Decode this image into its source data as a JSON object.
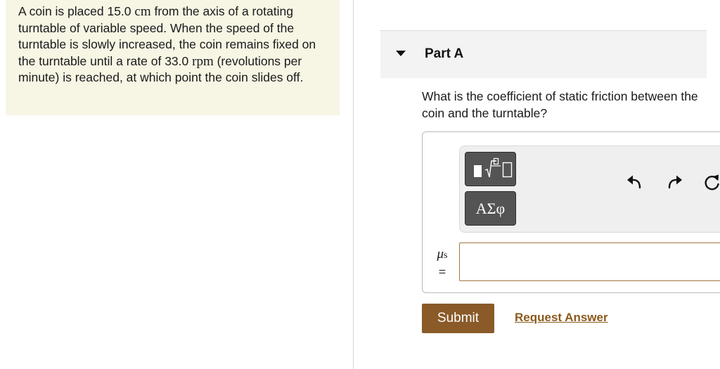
{
  "problem": {
    "text_1": "A coin is placed 15.0 ",
    "unit_cm": "cm",
    "text_2": " from the axis of a rotating turntable of variable speed. When the speed of the turntable is slowly increased, the coin remains fixed on the turntable until a rate of 33.0 ",
    "unit_rpm": "rpm",
    "text_3": " (revolutions per minute) is reached, at which point the coin slides off."
  },
  "part": {
    "title": "Part A",
    "question": "What is the coefficient of static friction between the coin and the turntable?"
  },
  "toolbar": {
    "templates_icon": "fraction-sqrt-template-icon",
    "symbols_label": "ΑΣφ",
    "undo_icon": "undo-icon",
    "redo_icon": "redo-icon",
    "reset_icon": "reset-icon"
  },
  "answer": {
    "var_symbol": "μ",
    "var_subscript": "s",
    "equals": "=",
    "value": ""
  },
  "actions": {
    "submit_label": "Submit",
    "request_label": "Request Answer"
  },
  "colors": {
    "problem_bg": "#f7f5e4",
    "submit_bg": "#8a5a28",
    "link": "#8a5a1c",
    "input_border": "#a0753a"
  }
}
